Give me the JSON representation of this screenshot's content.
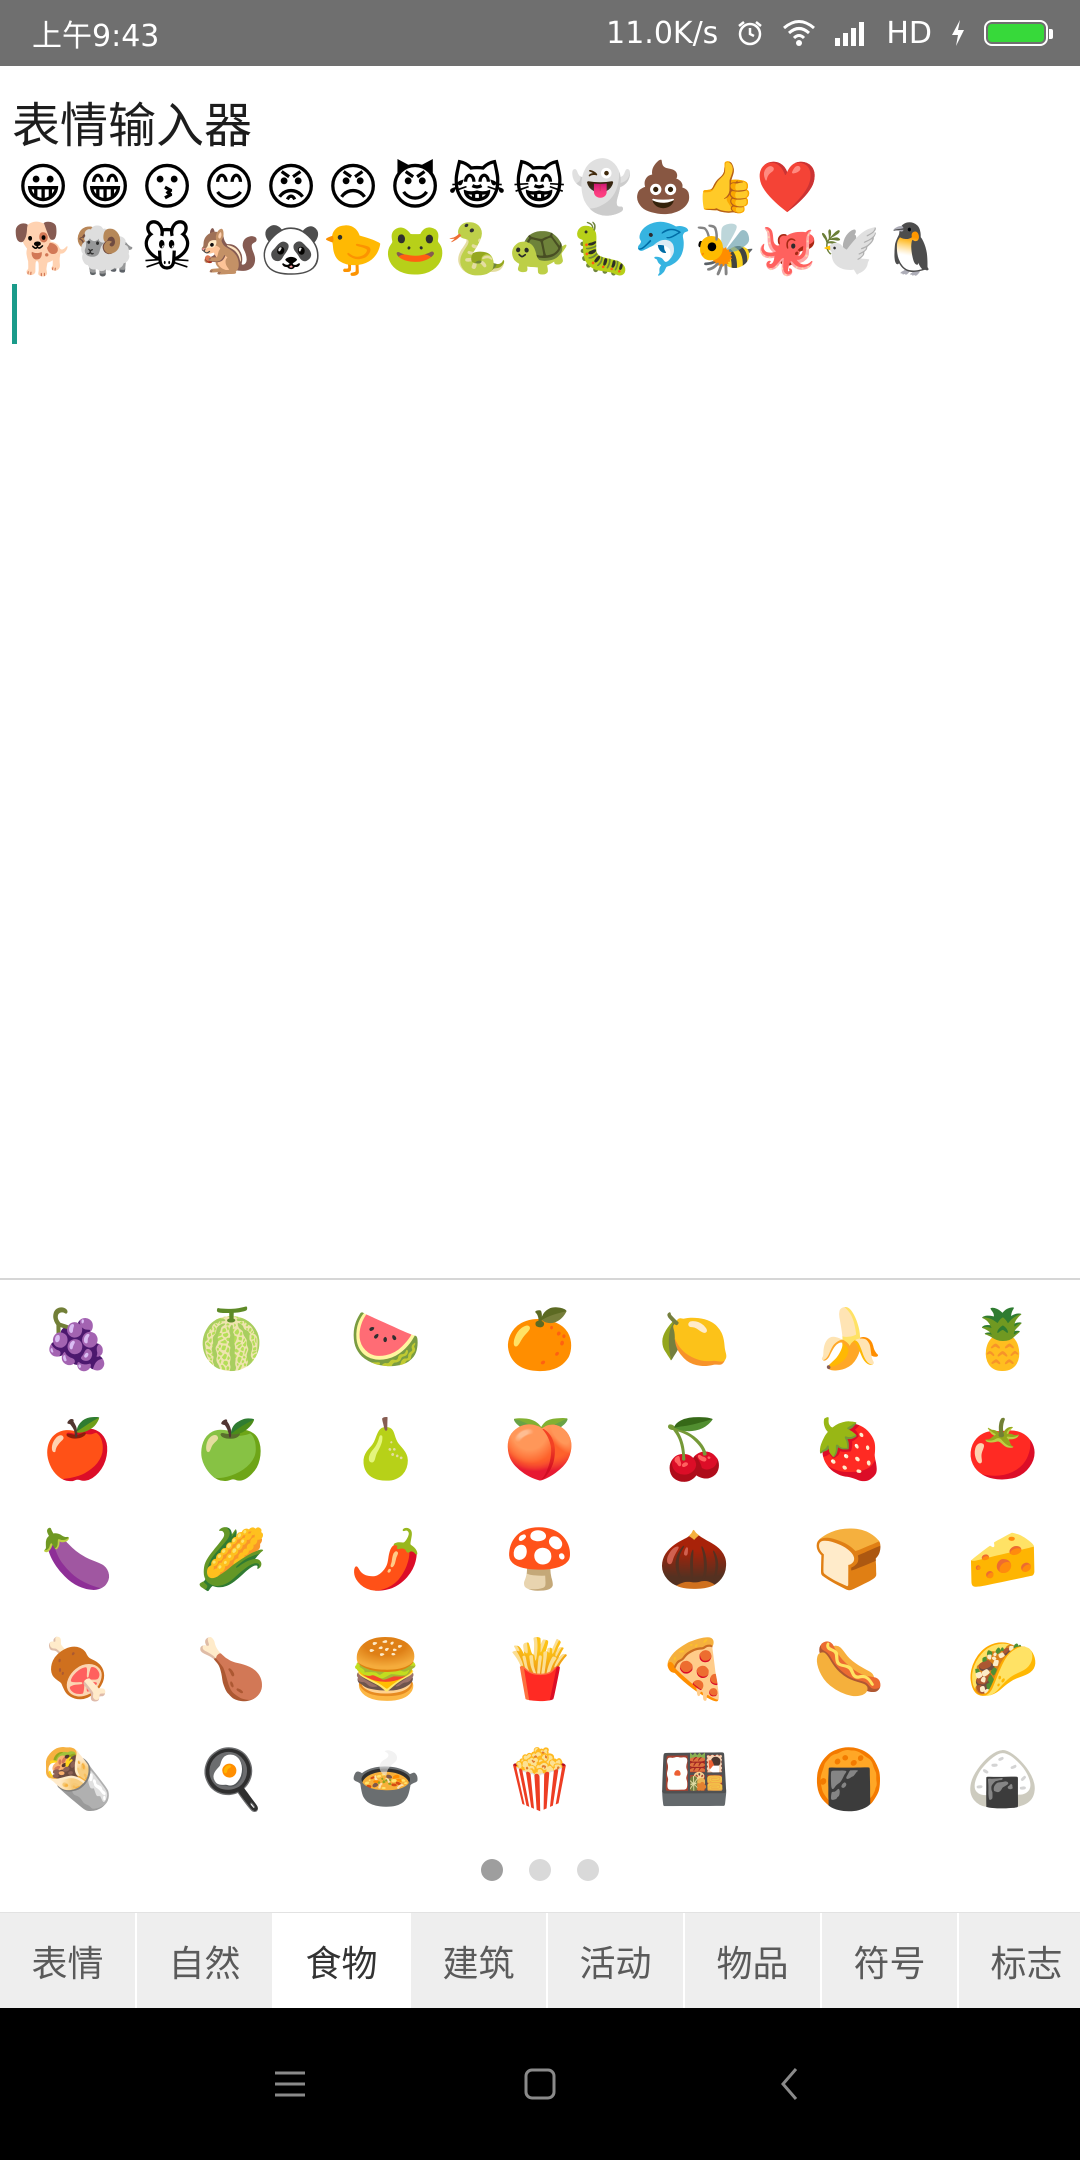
{
  "status_bar": {
    "time": "上午9:43",
    "network_speed": "11.0K/s",
    "hd_label": "HD",
    "battery_level": 1.0,
    "accent_battery_color": "#37d93a"
  },
  "editor": {
    "title": "表情输入器",
    "line1": [
      "😀",
      "😁",
      "😗",
      "😊",
      "😡",
      "😠",
      "😈",
      "😹",
      "😸",
      "👻",
      "💩",
      "👍",
      "❤️"
    ],
    "line2": [
      "🐕",
      "🐏",
      "🐭",
      "🐿️",
      "🐼",
      "🐤",
      "🐸",
      "🐍",
      "🐢",
      "🐛",
      "🐬",
      "🐝",
      "🐙",
      "🕊️",
      "🐧"
    ],
    "cursor_color": "#1a9b8a"
  },
  "emoji_grid": [
    "🍇",
    "🍈",
    "🍉",
    "🍊",
    "🍋",
    "🍌",
    "🍍",
    "🍎",
    "🍏",
    "🍐",
    "🍑",
    "🍒",
    "🍓",
    "🍅",
    "🍆",
    "🌽",
    "🌶️",
    "🍄",
    "🌰",
    "🍞",
    "🧀",
    "🍖",
    "🍗",
    "🍔",
    "🍟",
    "🍕",
    "🌭",
    "🌮",
    "🌯",
    "🍳",
    "🍲",
    "🍿",
    "🍱",
    "🍘",
    "🍙"
  ],
  "pager": {
    "pages": 3,
    "current": 1
  },
  "tabs": [
    {
      "label": "表情",
      "active": false
    },
    {
      "label": "自然",
      "active": false
    },
    {
      "label": "食物",
      "active": true
    },
    {
      "label": "建筑",
      "active": false
    },
    {
      "label": "活动",
      "active": false
    },
    {
      "label": "物品",
      "active": false
    },
    {
      "label": "符号",
      "active": false
    },
    {
      "label": "标志",
      "active": false
    }
  ],
  "nav_bar": {
    "icons": [
      "menu-icon",
      "home-icon",
      "back-icon"
    ]
  }
}
